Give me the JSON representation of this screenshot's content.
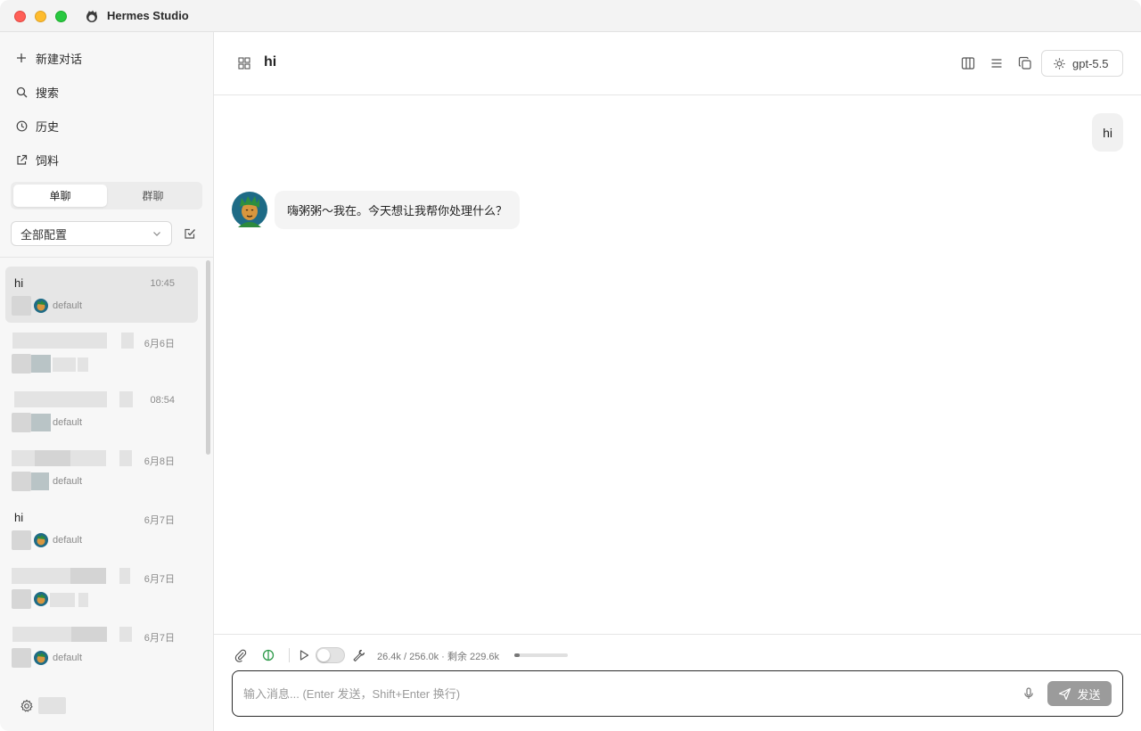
{
  "app": {
    "title": "Hermes Studio"
  },
  "sidebar": {
    "nav": [
      {
        "label": "新建对话",
        "icon": "plus-icon"
      },
      {
        "label": "搜索",
        "icon": "search-icon"
      },
      {
        "label": "历史",
        "icon": "clock-icon"
      },
      {
        "label": "饲料",
        "icon": "external-link-icon"
      }
    ],
    "segments": [
      "单聊",
      "群聊"
    ],
    "active_segment": "单聊",
    "filter": {
      "value": "全部配置"
    },
    "conversations": [
      {
        "title": "hi",
        "time": "10:45",
        "profile": "default"
      },
      {
        "title": "",
        "time": "6月6日",
        "profile": ""
      },
      {
        "title": "",
        "time": "08:54",
        "profile": "default"
      },
      {
        "title": "",
        "time": "6月8日",
        "profile": "default"
      },
      {
        "title": "hi",
        "time": "6月7日",
        "profile": "default"
      },
      {
        "title": "",
        "time": "6月7日",
        "profile": ""
      },
      {
        "title": "",
        "time": "6月7日",
        "profile": "default"
      }
    ]
  },
  "header": {
    "title": "hi",
    "model": "gpt-5.5"
  },
  "messages": [
    {
      "role": "user",
      "text": "hi"
    },
    {
      "role": "assistant",
      "text": "嗨粥粥～我在。今天想让我帮你处理什么？"
    }
  ],
  "composer": {
    "context_used": "26.4k",
    "context_total": "256.0k",
    "remaining_label": "剩余 229.6k",
    "context_fraction": 0.103,
    "placeholder": "输入消息... (Enter 发送，Shift+Enter 换行)",
    "send_label": "发送"
  },
  "colors": {
    "send_button": "#9b9b9b",
    "active_conversation": "#e6e6e6",
    "input_border": "#2a2a2a"
  }
}
